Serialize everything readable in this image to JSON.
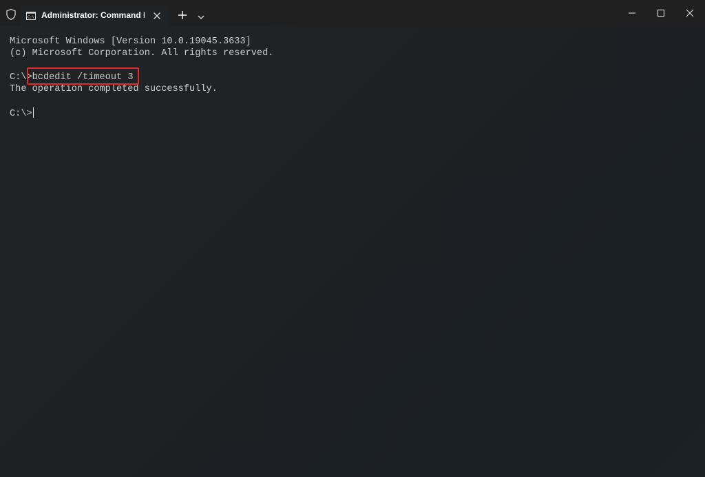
{
  "titlebar": {
    "tab_title": "Administrator: Command Prompt",
    "icons": {
      "shield": "shield-icon",
      "tab_icon": "command-prompt-icon",
      "tab_close": "close-icon",
      "new_tab": "plus-icon",
      "dropdown": "chevron-down-icon",
      "minimize": "minimize-icon",
      "maximize": "maximize-icon",
      "close": "close-icon"
    }
  },
  "console": {
    "header_line1": "Microsoft Windows [Version 10.0.19045.3633]",
    "header_line2": "(c) Microsoft Corporation. All rights reserved.",
    "prompt1": "C:\\>",
    "command1": "bcdedit /timeout 3",
    "output1": "The operation completed successfully.",
    "prompt2": "C:\\>"
  },
  "colors": {
    "titlebar_bg": "#202020",
    "console_bg": "#212325",
    "console_text": "#cccccc",
    "highlight": "#e12a2a"
  }
}
